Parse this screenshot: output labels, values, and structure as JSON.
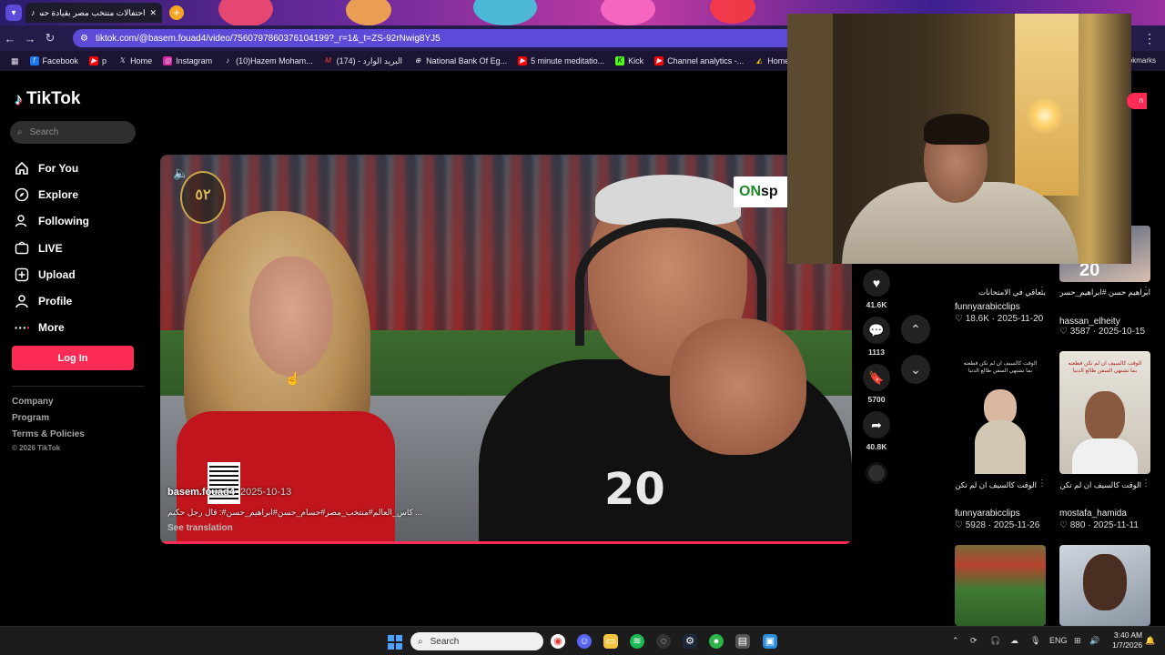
{
  "browser": {
    "tab_title": "احتفالات منتخب مصر بقيادة حسا",
    "url": "tiktok.com/@basem.fouad4/video/7560797860376104199?_r=1&_t=ZS-92rNwig8YJ5",
    "bookmarks": [
      "Facebook",
      "p",
      "Home",
      "Instagram",
      "(10)Hazem Moham...",
      "(174) - البريد الوارد",
      "National Bank Of Eg...",
      "5 minute meditatio...",
      "Kick",
      "Channel analytics -...",
      "Home – Google ..."
    ],
    "bookmarks_right": "okmarks"
  },
  "tiktok": {
    "brand": "TikTok",
    "search_placeholder": "Search",
    "nav": [
      "For You",
      "Explore",
      "Following",
      "LIVE",
      "Upload",
      "Profile",
      "More"
    ],
    "login": "Log In",
    "footer_links": [
      "Company",
      "Program",
      "Terms & Policies"
    ],
    "copyright": "© 2026 TikTok",
    "video": {
      "author": "basem.fouad4",
      "date": "2025-10-13",
      "caption": "... كاس_العالم#منتخب_مصر#حسام_حسن#ابراهيم_حسن#: قال رجل حكيم",
      "see_translation": "See translation",
      "channel_logo": "ON",
      "channel_logo_rest": "sp",
      "emblem_text": "٥٢",
      "shirt_number": "20"
    },
    "actions": {
      "likes": "41.6K",
      "comments": "1113",
      "saves": "5700",
      "shares": "40.8K"
    },
    "cards": [
      {
        "title": "بتعاقي في الامتحانات",
        "user": "funnyarabicclips",
        "views": "18.6K",
        "date": "2025-11-20"
      },
      {
        "title": "ابراهيم حسن #ابراهيم_حسن#...",
        "user": "hassan_elheity",
        "views": "3587",
        "date": "2025-10-15"
      },
      {
        "title": "الوقت كالسيف ان لم تكن قطعته بما تشتهي السفن طالع...",
        "user": "funnyarabicclips",
        "views": "5928",
        "date": "2025-11-26"
      },
      {
        "title": "الوقت كالسيف ان لم تكن قطعته بما تشتهي السفن طالع...",
        "user": "mostafa_hamida",
        "views": "880",
        "date": "2025-11-11"
      }
    ],
    "thumb_overlay_text": "الوقت كالسيف ان لم تكن قطعته بما تشتهي السفن طالع الدنيا",
    "thumb_label_20": "20"
  },
  "taskbar": {
    "search_placeholder": "Search",
    "lang": "ENG",
    "time": "3:40 AM",
    "date": "1/7/2026"
  },
  "colors": {
    "accent": "#fe2c55",
    "omnibox": "#5b4bd8"
  }
}
